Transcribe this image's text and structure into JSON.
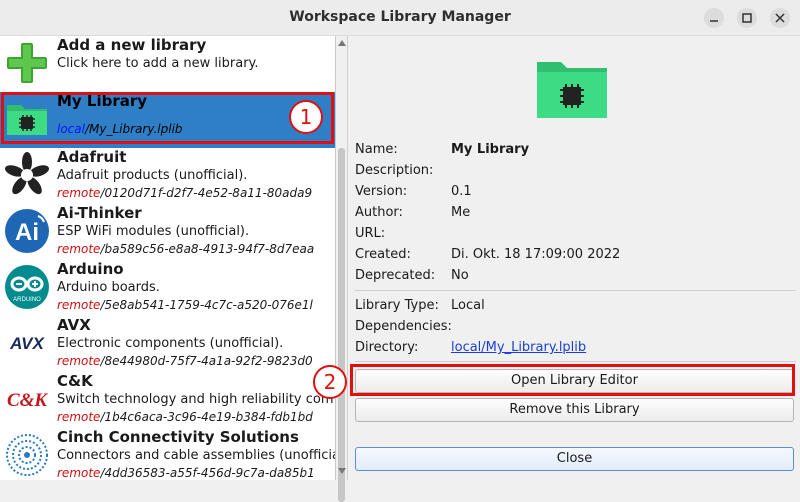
{
  "window": {
    "title": "Workspace Library Manager"
  },
  "libraries": [
    {
      "name": "Add a new library",
      "desc": "Click here to add a new library.",
      "scheme": "",
      "path": "",
      "icon": "plus-icon"
    },
    {
      "name": "My Library",
      "desc": "",
      "scheme": "local",
      "path": "/My_Library.lplib",
      "icon": "library-folder-icon"
    },
    {
      "name": "Adafruit",
      "desc": "Adafruit products (unofficial).",
      "scheme": "remote",
      "path": "/0120d71f-d2f7-4e52-8a11-80ada9",
      "icon": "adafruit-logo-icon"
    },
    {
      "name": "Ai-Thinker",
      "desc": "ESP WiFi modules (unofficial).",
      "scheme": "remote",
      "path": "/ba589c56-e8a8-4913-94f7-8d7eaa",
      "icon": "ai-thinker-logo-icon"
    },
    {
      "name": "Arduino",
      "desc": "Arduino boards.",
      "scheme": "remote",
      "path": "/5e8ab541-1759-4c7c-a520-076e1l",
      "icon": "arduino-logo-icon"
    },
    {
      "name": "AVX",
      "desc": "Electronic components (unofficial).",
      "scheme": "remote",
      "path": "/8e44980d-75f7-4a1a-92f2-9823d0",
      "icon": "avx-logo-icon"
    },
    {
      "name": "C&K",
      "desc": "Switch technology and high reliability com",
      "scheme": "remote",
      "path": "/1b4c6aca-3c96-4e19-b384-fdb1bd",
      "icon": "ck-logo-icon"
    },
    {
      "name": "Cinch Connectivity Solutions",
      "desc": "Connectors and cable assemblies (unofficia",
      "scheme": "remote",
      "path": "/4dd36583-a55f-456d-9c7a-da85b1",
      "icon": "cinch-logo-icon"
    }
  ],
  "details": {
    "fields": [
      {
        "label": "Name:",
        "value": "My Library"
      },
      {
        "label": "Description:",
        "value": ""
      },
      {
        "label": "Version:",
        "value": "0.1"
      },
      {
        "label": "Author:",
        "value": "Me"
      },
      {
        "label": "URL:",
        "value": ""
      },
      {
        "label": "Created:",
        "value": "Di. Okt. 18 17:09:00 2022"
      },
      {
        "label": "Deprecated:",
        "value": "No"
      }
    ],
    "fields2": [
      {
        "label": "Library Type:",
        "value": "Local"
      },
      {
        "label": "Dependencies:",
        "value": ""
      },
      {
        "label": "Directory:",
        "value": "local/My_Library.lplib"
      }
    ],
    "open_editor_label": "Open Library Editor",
    "remove_label": "Remove this Library",
    "close_label": "Close"
  },
  "annotations": {
    "badge1": "1",
    "badge2": "2"
  },
  "colors": {
    "selection": "#2f7fc6",
    "highlight": "#e01010",
    "folder_green": "#3ddc84"
  }
}
